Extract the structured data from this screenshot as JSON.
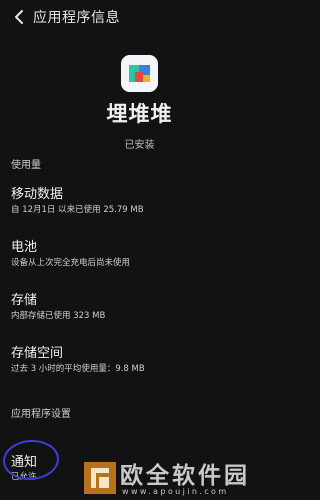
{
  "header": {
    "title": "应用程序信息"
  },
  "app": {
    "name": "埋堆堆",
    "status": "已安装"
  },
  "sections": {
    "usage": "使用量",
    "settings": "应用程序设置"
  },
  "rows": {
    "mobile_data": {
      "label": "移动数据",
      "sub": "自 12月1日 以来已使用 25.79 MB"
    },
    "battery": {
      "label": "电池",
      "sub": "设备从上次完全充电后尚未使用"
    },
    "storage": {
      "label": "存储",
      "sub": "内部存储已使用 323 MB"
    },
    "storage_space": {
      "label": "存储空间",
      "sub": "过去 3 小时的平均使用量：9.8 MB"
    },
    "notifications": {
      "label": "通知",
      "sub": "已允许"
    }
  },
  "watermark": {
    "text": "欧全软件园",
    "url": "www.apoujin.com"
  },
  "colors": {
    "background": "#121212",
    "annotation_circle": "#3c3fd6",
    "watermark_logo": "#b8731a"
  },
  "icons": {
    "back": "chevron-left-icon",
    "app": "app-logo-icon",
    "watermark": "watermark-logo-icon"
  }
}
